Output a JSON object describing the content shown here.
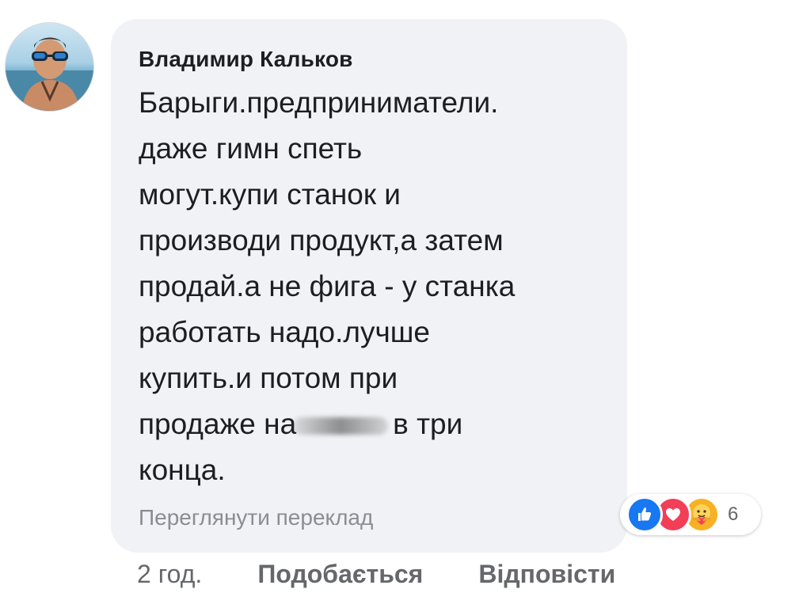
{
  "comment": {
    "author": "Владимир Кальков",
    "text_lines": [
      "Барыги.предприниматели.",
      "даже гимн спеть",
      "могут.купи станок и",
      "производи продукт,а затем",
      "продай.а не фига - у станка",
      "работать надо.лучше",
      "купить.и потом при"
    ],
    "text_line_blurred_before": "продаже на",
    "text_line_blurred_after": "в три",
    "text_last_line": "конца.",
    "translate_link": "Переглянути переклад",
    "reactions": {
      "icons": [
        "like-icon",
        "love-icon",
        "care-icon"
      ],
      "count": "6"
    },
    "time": "2 год.",
    "like_label": "Подобається",
    "reply_label": "Відповісти"
  },
  "colors": {
    "bubble": "#f0f2f5",
    "text": "#1c1e21",
    "muted": "#65676b",
    "like": "#1877f2",
    "love": "#f33e58",
    "care": "#f7b125"
  }
}
